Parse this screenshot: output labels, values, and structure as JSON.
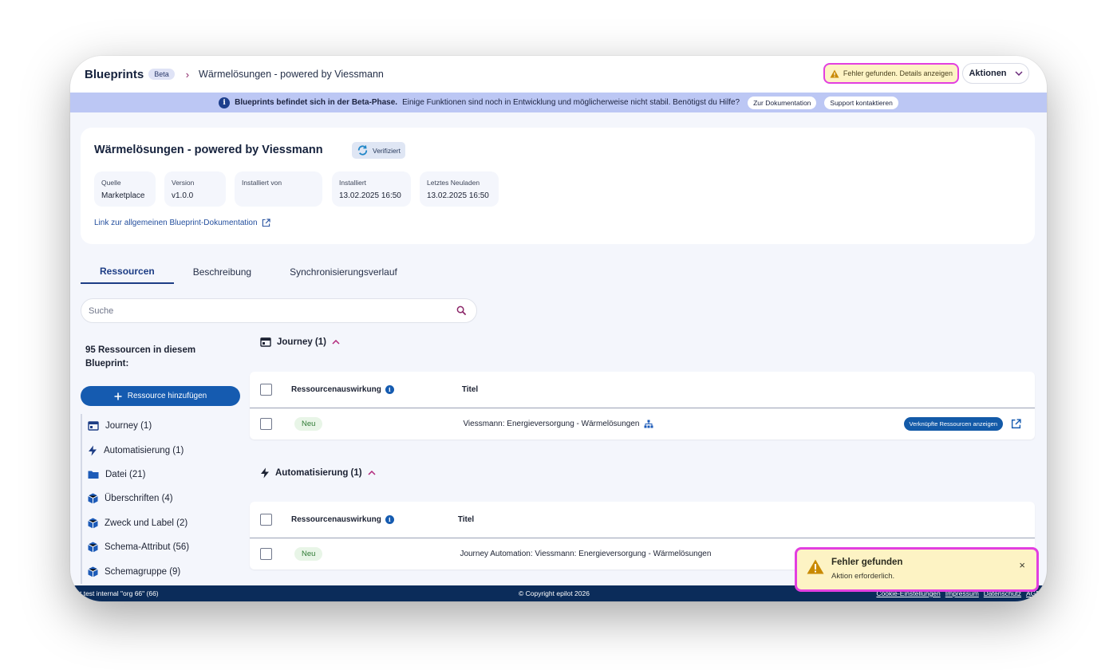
{
  "header": {
    "brand": "Blueprints",
    "beta_badge": "Beta",
    "breadcrumb_sep": "›",
    "breadcrumb": "Wärmelösungen - powered by Viessmann",
    "error_chip": "Fehler gefunden. Details anzeigen",
    "actions_label": "Aktionen"
  },
  "banner": {
    "bold": "Blueprints befindet sich in der Beta-Phase.",
    "text": "Einige Funktionen sind noch in Entwicklung und möglicherweise nicht stabil. Benötigst du Hilfe?",
    "docs_button": "Zur Dokumentation",
    "support_button": "Support kontaktieren"
  },
  "blueprint": {
    "title": "Wärmelösungen - powered by Viessmann",
    "verified_label": "Verifiziert",
    "meta": [
      {
        "label": "Quelle",
        "value": "Marketplace"
      },
      {
        "label": "Version",
        "value": "v1.0.0"
      },
      {
        "label": "Installiert von",
        "value": ""
      },
      {
        "label": "Installiert",
        "value": "13.02.2025 16:50"
      },
      {
        "label": "Letztes Neuladen",
        "value": "13.02.2025 16:50"
      }
    ],
    "doc_link": "Link zur allgemeinen Blueprint-Dokumentation"
  },
  "tabs": [
    "Ressourcen",
    "Beschreibung",
    "Synchronisierungsverlauf"
  ],
  "search": {
    "placeholder": "Suche"
  },
  "sidebar": {
    "count_label": "95 Ressourcen in diesem Blueprint:",
    "add_button": "Ressource hinzufügen",
    "items": [
      {
        "label": "Journey (1)",
        "icon": "journey-icon"
      },
      {
        "label": "Automatisierung (1)",
        "icon": "lightning-icon"
      },
      {
        "label": "Datei (21)",
        "icon": "folder-icon"
      },
      {
        "label": "Überschriften (4)",
        "icon": "cube-icon"
      },
      {
        "label": "Zweck und Label (2)",
        "icon": "cube-icon"
      },
      {
        "label": "Schema-Attribut (56)",
        "icon": "cube-icon"
      },
      {
        "label": "Schemagruppe (9)",
        "icon": "cube-icon"
      }
    ]
  },
  "sections": {
    "journey": {
      "title": "Journey (1)",
      "col_impact": "Ressourcenauswirkung",
      "col_title": "Titel",
      "row_status": "Neu",
      "row_title": "Viessmann: Energieversorgung - Wärmelösungen",
      "linked_button": "Verknüpfte Ressourcen anzeigen"
    },
    "automation": {
      "title": "Automatisierung (1)",
      "col_impact": "Ressourcenauswirkung",
      "col_title": "Titel",
      "row_status": "Neu",
      "row_title": "Journey Automation: Viessmann: Energieversorgung - Wärmelösungen"
    }
  },
  "footer": {
    "left": "t test internal \"org 66\" (66)",
    "center": "© Copyright epilot 2026",
    "links": [
      "Cookie-Einstellungen",
      "Impressum",
      "Datenschutz",
      "AGB"
    ]
  },
  "toast": {
    "title": "Fehler gefunden",
    "message": "Aktion erforderlich.",
    "close": "×"
  },
  "colors": {
    "primary": "#155bb0",
    "accent": "#b1287b",
    "highlight": "#e23fe0",
    "warning_bg": "#fdf3c4",
    "footer": "#0b2c5a"
  }
}
